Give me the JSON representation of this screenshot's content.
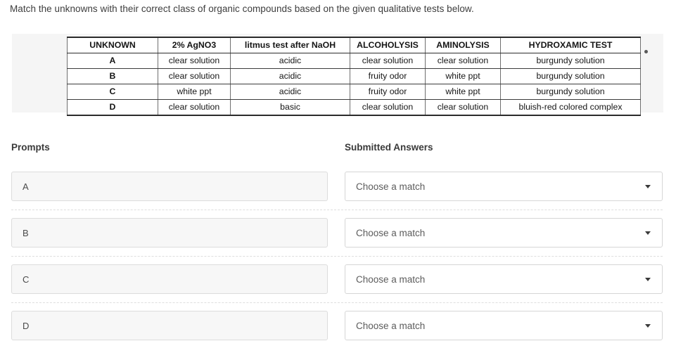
{
  "question": {
    "text": "Match the unknowns with their correct class of organic compounds based on the given qualitative tests below."
  },
  "attachment": {
    "menu_icon": "ellipsis-icon",
    "table": {
      "headers": [
        "UNKNOWN",
        "2% AgNO3",
        "litmus test after NaOH",
        "ALCOHOLYSIS",
        "AMINOLYSIS",
        "HYDROXAMIC TEST"
      ],
      "rows": [
        [
          "A",
          "clear solution",
          "acidic",
          "clear solution",
          "clear solution",
          "burgundy solution"
        ],
        [
          "B",
          "clear solution",
          "acidic",
          "fruity odor",
          "white ppt",
          "burgundy solution"
        ],
        [
          "C",
          "white ppt",
          "acidic",
          "fruity odor",
          "white ppt",
          "burgundy solution"
        ],
        [
          "D",
          "clear solution",
          "basic",
          "clear solution",
          "clear solution",
          "bluish-red colored complex"
        ]
      ]
    }
  },
  "matching": {
    "prompts_header": "Prompts",
    "answers_header": "Submitted Answers",
    "rows": [
      {
        "prompt": "A",
        "answer": "Choose a match",
        "caret_icon": "chevron-down-icon"
      },
      {
        "prompt": "B",
        "answer": "Choose a match",
        "caret_icon": "chevron-down-icon"
      },
      {
        "prompt": "C",
        "answer": "Choose a match",
        "caret_icon": "chevron-down-icon"
      },
      {
        "prompt": "D",
        "answer": "Choose a match",
        "caret_icon": "chevron-down-icon"
      }
    ]
  },
  "colors": {
    "page_background": "#ffffff",
    "attachment_background": "#f5f5f5",
    "prompt_fill": "#f7f7f7",
    "border": "#dcdcdc",
    "text": "#333333"
  }
}
